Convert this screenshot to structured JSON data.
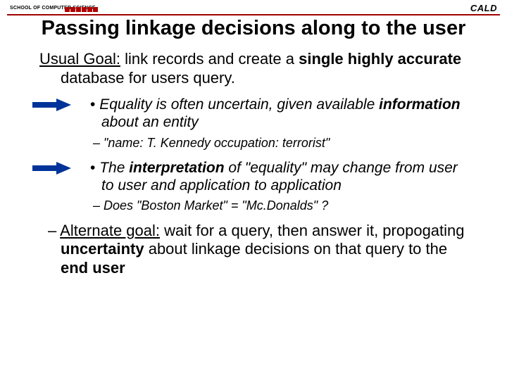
{
  "header": {
    "left_label": "SCHOOL OF COMPUTER SCIENCE",
    "right_label": "CALD"
  },
  "title": "Passing linkage decisions along to the user",
  "para": {
    "prefix": "Usual Goal:",
    "mid1": " link records and create a ",
    "bold1": "single highly accurate",
    "tail": " database for users query."
  },
  "bullets": [
    {
      "lead": "• ",
      "seg1": "Equality is often uncertain, given available ",
      "bold": "information",
      "seg2": " about an entity",
      "sub": "– \"name: T. Kennedy occupation: terrorist\""
    },
    {
      "lead": "• ",
      "seg1": "The ",
      "bold": "interpretation",
      "seg2": " of \"equality\" may change from user to user and application to application",
      "sub": "– Does \"Boston Market\" = \"Mc.Donalds\" ?"
    }
  ],
  "alt": {
    "dash": "– ",
    "prefix": "Alternate goal:",
    "seg1": " wait for a query, then answer it, propogating ",
    "bold1": "uncertainty",
    "seg2": " about linkage decisions on that query to the ",
    "bold2": "end user"
  }
}
